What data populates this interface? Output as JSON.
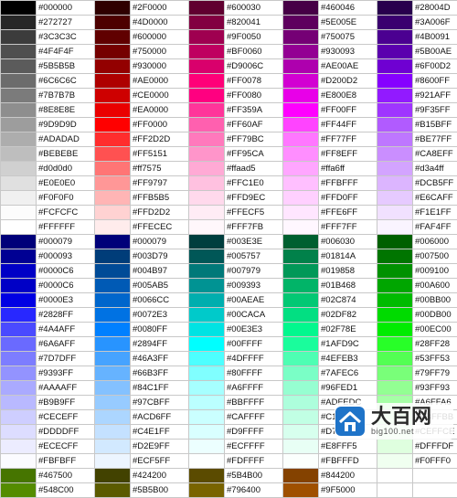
{
  "color_table": {
    "rows": [
      [
        "#000000",
        "#2F0000",
        "#600030",
        "#460046",
        "#28004D"
      ],
      [
        "#272727",
        "#4D0000",
        "#820041",
        "#5E005E",
        "#3A006F"
      ],
      [
        "#3C3C3C",
        "#600000",
        "#9F0050",
        "#750075",
        "#4B0091"
      ],
      [
        "#4F4F4F",
        "#750000",
        "#BF0060",
        "#930093",
        "#5B00AE"
      ],
      [
        "#5B5B5B",
        "#930000",
        "#D9006C",
        "#AE00AE",
        "#6F00D2"
      ],
      [
        "#6C6C6C",
        "#AE0000",
        "#FF0078",
        "#D200D2",
        "#8600FF"
      ],
      [
        "#7B7B7B",
        "#CE0000",
        "#FF0080",
        "#E800E8",
        "#921AFF"
      ],
      [
        "#8E8E8E",
        "#EA0000",
        "#FF359A",
        "#FF00FF",
        "#9F35FF"
      ],
      [
        "#9D9D9D",
        "#FF0000",
        "#FF60AF",
        "#FF44FF",
        "#B15BFF"
      ],
      [
        "#ADADAD",
        "#FF2D2D",
        "#FF79BC",
        "#FF77FF",
        "#BE77FF"
      ],
      [
        "#BEBEBE",
        "#FF5151",
        "#FF95CA",
        "#FF8EFF",
        "#CA8EFF"
      ],
      [
        "#d0d0d0",
        "#ff7575",
        "#ffaad5",
        "#ffa6ff",
        "#d3a4ff"
      ],
      [
        "#E0E0E0",
        "#FF9797",
        "#FFC1E0",
        "#FFBFFF",
        "#DCB5FF"
      ],
      [
        "#F0F0F0",
        "#FFB5B5",
        "#FFD9EC",
        "#FFD0FF",
        "#E6CAFF"
      ],
      [
        "#FCFCFC",
        "#FFD2D2",
        "#FFECF5",
        "#FFE6FF",
        "#F1E1FF"
      ],
      [
        "#FFFFFF",
        "#FFECEC",
        "#FFF7FB",
        "#FFF7FF",
        "#FAF4FF"
      ],
      [
        "#000079",
        "#000079",
        "#003E3E",
        "#006030",
        "#006000"
      ],
      [
        "#000093",
        "#003D79",
        "#005757",
        "#01814A",
        "#007500"
      ],
      [
        "#0000C6",
        "#004B97",
        "#007979",
        "#019858",
        "#009100"
      ],
      [
        "#0000C6",
        "#005AB5",
        "#009393",
        "#01B468",
        "#00A600"
      ],
      [
        "#0000E3",
        "#0066CC",
        "#00AEAE",
        "#02C874",
        "#00BB00"
      ],
      [
        "#2828FF",
        "#0072E3",
        "#00CACA",
        "#02DF82",
        "#00DB00"
      ],
      [
        "#4A4AFF",
        "#0080FF",
        "#00E3E3",
        "#02F78E",
        "#00EC00"
      ],
      [
        "#6A6AFF",
        "#2894FF",
        "#00FFFF",
        "#1AFD9C",
        "#28FF28"
      ],
      [
        "#7D7DFF",
        "#46A3FF",
        "#4DFFFF",
        "#4EFEB3",
        "#53FF53"
      ],
      [
        "#9393FF",
        "#66B3FF",
        "#80FFFF",
        "#7AFEC6",
        "#79FF79"
      ],
      [
        "#AAAAFF",
        "#84C1FF",
        "#A6FFFF",
        "#96FED1",
        "#93FF93"
      ],
      [
        "#B9B9FF",
        "#97CBFF",
        "#BBFFFF",
        "#ADFEDC",
        "#A6FFA6"
      ],
      [
        "#CECEFF",
        "#ACD6FF",
        "#CAFFFF",
        "#C1FFE4",
        "#BBFFBB"
      ],
      [
        "#DDDDFF",
        "#C4E1FF",
        "#D9FFFF",
        "#D7FFEE",
        "#CEFFCE"
      ],
      [
        "#ECECFF",
        "#D2E9FF",
        "#ECFFFF",
        "#E8FFF5",
        "#DFFFDF"
      ],
      [
        "#FBFBFF",
        "#ECF5FF",
        "#FDFFFF",
        "#FBFFFD",
        "#F0FFF0"
      ],
      [
        "#467500",
        "#424200",
        "#5B4B00",
        "#844200",
        ""
      ],
      [
        "#548C00",
        "#5B5B00",
        "#796400",
        "#9F5000",
        ""
      ]
    ]
  },
  "watermark": {
    "main_text": "大百网",
    "sub_text": "big100.net",
    "icon": "house-logo-icon",
    "icon_color": "#1e73c8"
  }
}
